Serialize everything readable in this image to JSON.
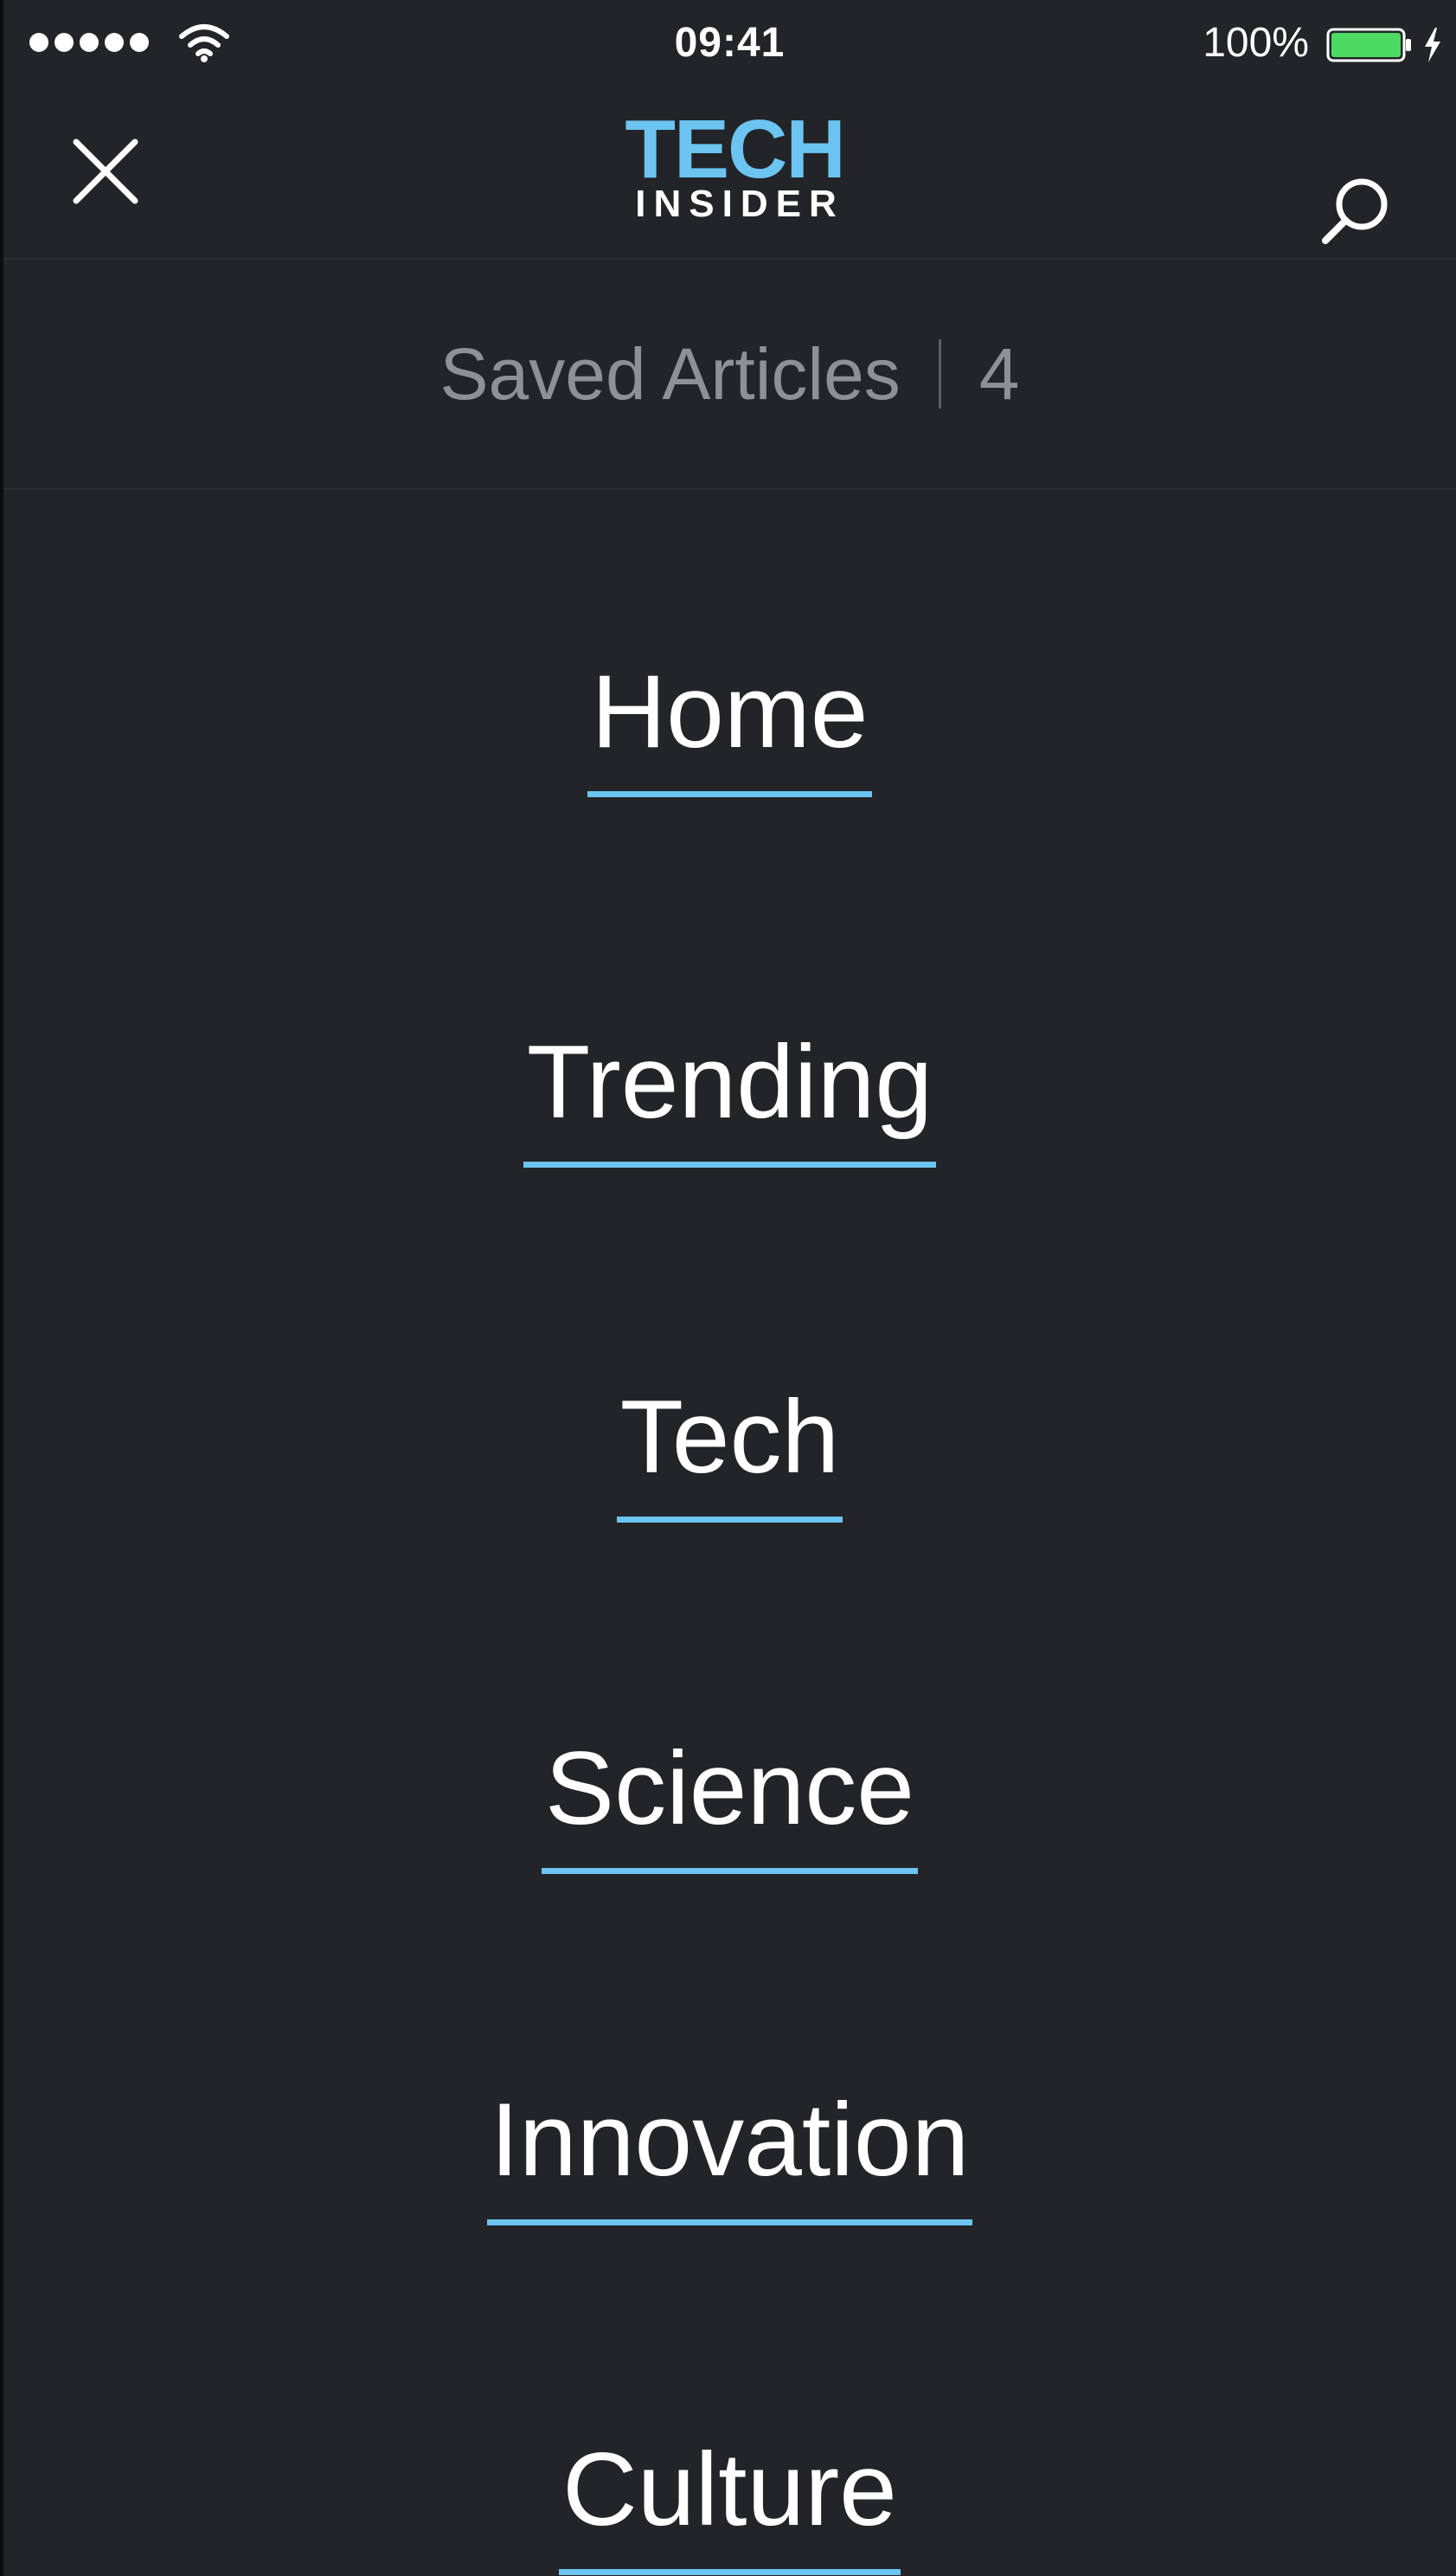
{
  "status_bar": {
    "time": "09:41",
    "battery_percent": "100%",
    "battery_level": 1.0,
    "signal_bars": 5,
    "battery_color": "#4cd964"
  },
  "header": {
    "close_icon": "close-icon",
    "logo_line1": "TECH",
    "logo_line2": "INSIDER",
    "search_icon": "search-icon",
    "brand_color": "#6cc4f0"
  },
  "saved": {
    "label": "Saved Articles",
    "count": "4"
  },
  "menu": {
    "items": [
      {
        "label": "Home"
      },
      {
        "label": "Trending"
      },
      {
        "label": "Tech"
      },
      {
        "label": "Science"
      },
      {
        "label": "Innovation"
      },
      {
        "label": "Culture"
      }
    ]
  },
  "colors": {
    "background": "#222427",
    "accent": "#6cc4f0",
    "muted_text": "#8e9094"
  }
}
